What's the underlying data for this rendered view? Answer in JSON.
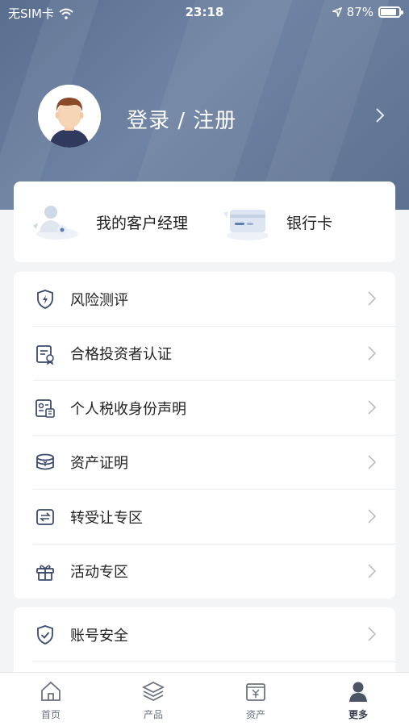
{
  "status_bar": {
    "carrier": "无SIM卡",
    "time": "23:18",
    "battery_percent": "87%",
    "battery_level": 0.87,
    "icons": [
      "wifi-icon",
      "location-arrow-icon",
      "battery-icon"
    ]
  },
  "profile": {
    "login_label": "登录 / 注册",
    "avatar_icon": "user-avatar-icon"
  },
  "quick_actions": [
    {
      "label": "我的客户经理",
      "icon": "customer-manager-icon"
    },
    {
      "label": "银行卡",
      "icon": "bank-card-icon"
    }
  ],
  "menu": [
    {
      "label": "风险测评",
      "icon": "shield-bolt-icon"
    },
    {
      "label": "合格投资者认证",
      "icon": "certificate-icon"
    },
    {
      "label": "个人税收身份声明",
      "icon": "id-card-icon"
    },
    {
      "label": "资产证明",
      "icon": "coin-stack-icon"
    },
    {
      "label": "转受让专区",
      "icon": "transfer-icon"
    },
    {
      "label": "活动专区",
      "icon": "gift-icon"
    }
  ],
  "security": [
    {
      "label": "账号安全",
      "icon": "shield-check-icon"
    }
  ],
  "tabbar": {
    "tabs": [
      {
        "label": "首页",
        "icon": "home-icon"
      },
      {
        "label": "产品",
        "icon": "layers-icon"
      },
      {
        "label": "资产",
        "icon": "wallet-yuan-icon"
      },
      {
        "label": "更多",
        "icon": "person-icon"
      }
    ],
    "active": "更多"
  },
  "colors": {
    "hero": "#5f7394",
    "icon": "#3b4a6b",
    "active_tab": "#374151",
    "inactive_tab": "#6b7280"
  }
}
